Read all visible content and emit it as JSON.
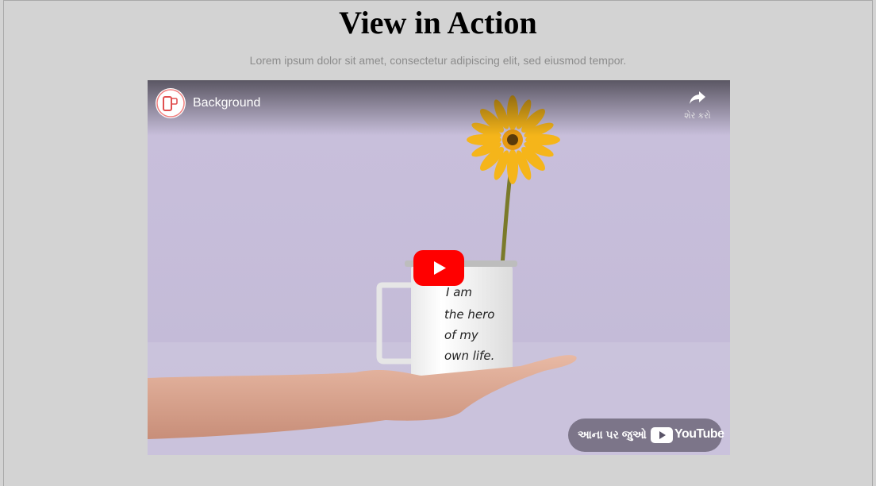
{
  "page": {
    "title": "View in Action",
    "subtitle": "Lorem ipsum dolor sit amet, consectetur adipiscing elit, sed eiusmod tempor."
  },
  "video": {
    "channel_avatar": "channel-logo-icon",
    "title": "Background",
    "share_icon": "share-arrow-icon",
    "share_label": "શેર કરો",
    "play_icon": "play-icon",
    "watch_on_label": "આના પર જુઓ",
    "brand": "YouTube",
    "mug_text": [
      "I am",
      "the hero",
      "of my",
      "own life."
    ],
    "colors": {
      "play_red": "#ff0000",
      "background_lavender": "#c5bdd8",
      "petals": "#f7b81e"
    }
  }
}
